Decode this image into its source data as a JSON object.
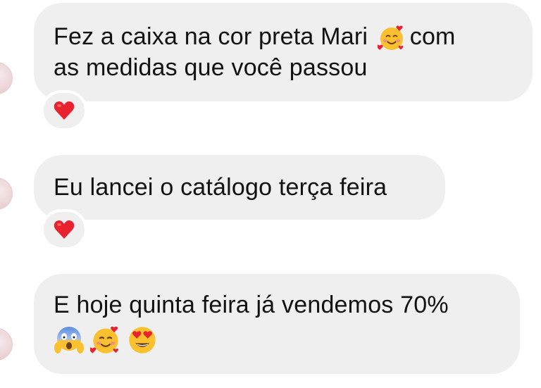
{
  "messages": [
    {
      "line1": "Fez a caixa na cor preta Mari",
      "emoji_after_line1": "smiling-face-with-hearts-icon",
      "line1_tail": "com",
      "line2": "as medidas que você passou",
      "reaction": "red-heart-icon"
    },
    {
      "line1": "Eu lancei o catálogo terça feira",
      "reaction": "red-heart-icon"
    },
    {
      "line1": "E hoje quinta feira já vendemos 70%",
      "emojis": [
        "face-screaming-in-fear-icon",
        "smiling-face-with-hearts-icon",
        "smiling-face-with-heart-eyes-icon"
      ]
    }
  ],
  "colors": {
    "bubble_background": "#efeff0",
    "text": "#111111",
    "heart": "#e8222e",
    "emoji_yellow": "#fbc02d"
  }
}
